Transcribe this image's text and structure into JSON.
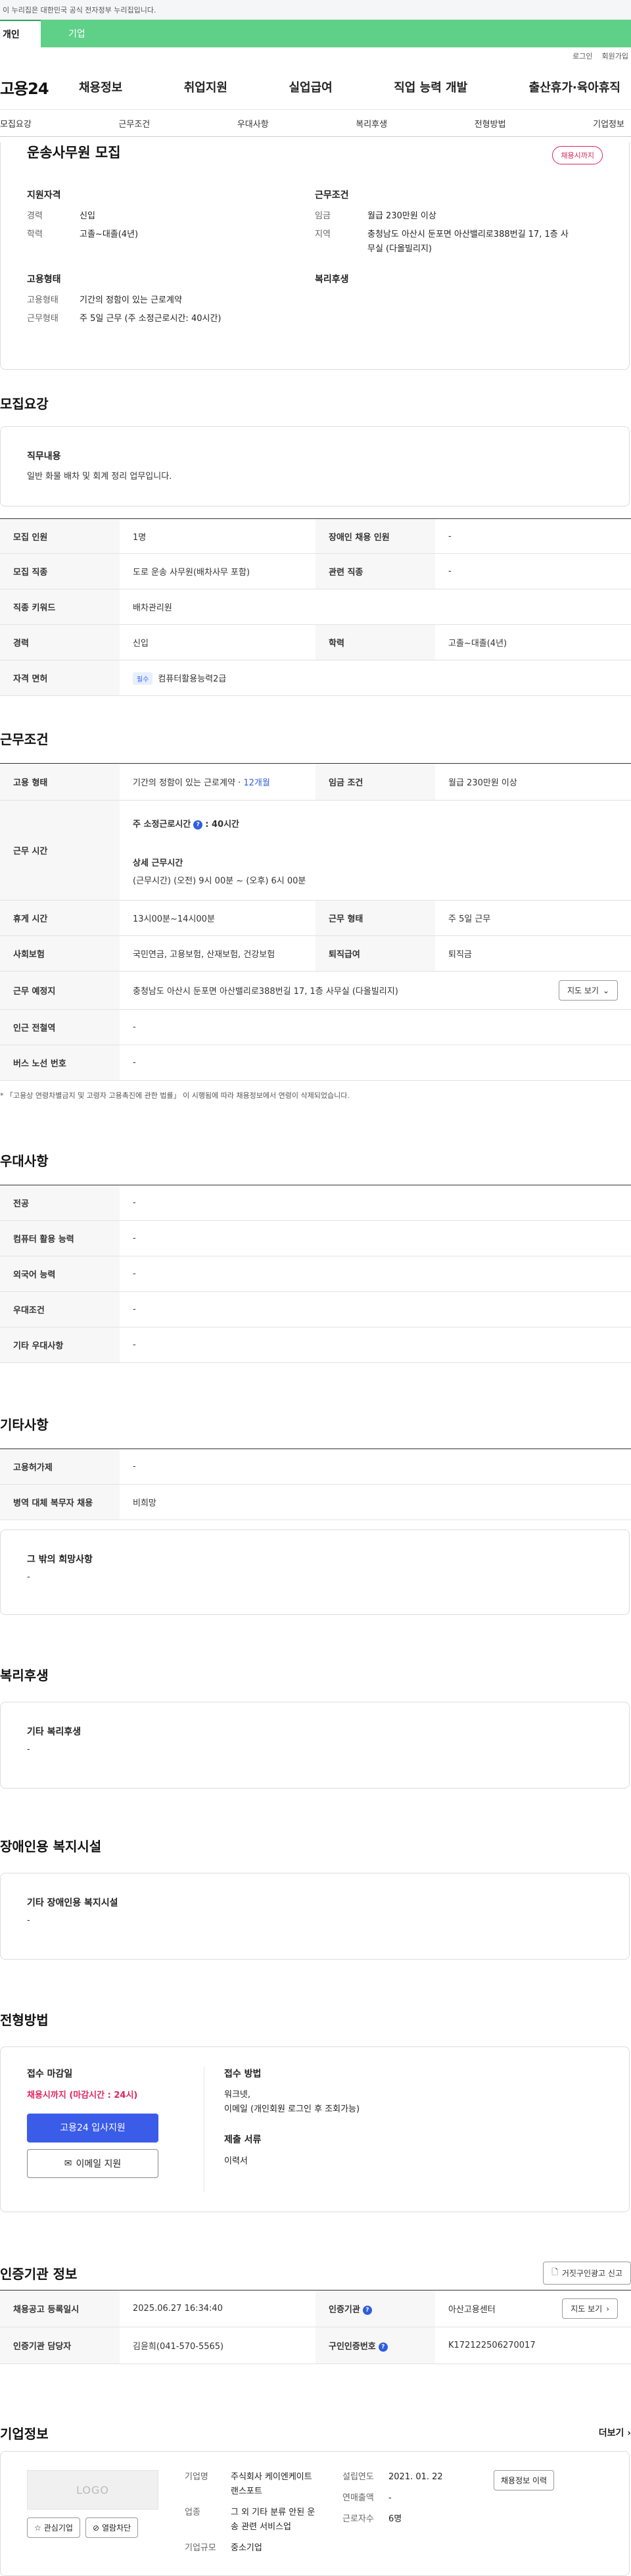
{
  "header": {
    "gov_notice": "이 누리집은 대한민국 공식 전자정부 누리집입니다.",
    "tab_personal": "개인",
    "tab_company": "기업",
    "login": "로그인",
    "join": "회원가입",
    "logo": "고용24",
    "menu": [
      "채용정보",
      "취업지원",
      "실업급여",
      "직업 능력 개발",
      "출산휴가·육아휴직"
    ]
  },
  "anchor_tabs": [
    "모집요강",
    "근무조건",
    "우대사항",
    "복리후생",
    "전형방법",
    "기업정보"
  ],
  "summary": {
    "title": "운송사무원 모집",
    "status": "채용시까지",
    "qualify_title": "지원자격",
    "career_label": "경력",
    "career_value": "신입",
    "edu_label": "학력",
    "edu_value": "고졸~대졸(4년)",
    "work_title": "근무조건",
    "wage_label": "임금",
    "wage_value": "월급 230만원 이상",
    "area_label": "지역",
    "area_value": "충청남도 아산시 둔포면 아산밸리로388번길 17, 1층 사무실 (다올빌리지)",
    "emp_title": "고용형태",
    "emp_type_label": "고용형태",
    "emp_type_value": "기간의 정함이 있는 근로계약",
    "work_form_label": "근무형태",
    "work_form_value": "주 5일 근무 (주 소정근로시간: 40시간)",
    "welfare_title": "복리후생"
  },
  "recruit": {
    "section_title": "모집요강",
    "duty_title": "직무내용",
    "duty_value": "일반 화물 배차 및 회계 정리 업무입니다.",
    "count_label": "모집 인원",
    "count_value": "1명",
    "disabled_label": "장애인 채용 인원",
    "disabled_value": "-",
    "job_label": "모집 직종",
    "job_value": "도로 운송 사무원(배차사무 포함)",
    "related_label": "관련 직종",
    "related_value": "-",
    "keyword_label": "직종 키워드",
    "keyword_value": "배차관리원",
    "career_label": "경력",
    "career_value": "신입",
    "edu_label": "학력",
    "edu_value": "고졸~대졸(4년)",
    "license_label": "자격 면허",
    "license_tag": "필수",
    "license_value": "컴퓨터활용능력2급"
  },
  "conditions": {
    "section_title": "근무조건",
    "emp_label": "고용 형태",
    "emp_value": "기간의 정함이 있는 근로계약 · ",
    "emp_period": "12개월",
    "wage_label": "임금 조건",
    "wage_value": "월급 230만원 이상",
    "hours_label": "근무 시간",
    "hours_title": "주 소정근로시간",
    "hours_value": ": 40시간",
    "detail_title": "상세 근무시간",
    "detail_value": "(근무시간) (오전) 9시 00분 ~ (오후) 6시 00분",
    "break_label": "휴게 시간",
    "break_value": "13시00분~14시00분",
    "form_label": "근무 형태",
    "form_value": "주 5일 근무",
    "insurance_label": "사회보험",
    "insurance_value": "국민연금, 고용보험, 산재보험, 건강보험",
    "retire_label": "퇴직급여",
    "retire_value": "퇴직금",
    "place_label": "근무 예정지",
    "place_value": "충청남도 아산시 둔포면 아산밸리로388번길 17, 1층 사무실 (다올빌리지)",
    "map_btn": "지도 보기",
    "subway_label": "인근 전철역",
    "subway_value": "-",
    "bus_label": "버스 노선 번호",
    "bus_value": "-",
    "note": "* 「고용상 연령차별금지 및 고령자 고용촉진에 관한 법률」 이 시행됨에 따라 채용정보에서 연령이 삭제되었습니다."
  },
  "preference": {
    "section_title": "우대사항",
    "rows": [
      {
        "label": "전공",
        "value": "-"
      },
      {
        "label": "컴퓨터 활용 능력",
        "value": "-"
      },
      {
        "label": "외국어 능력",
        "value": "-"
      },
      {
        "label": "우대조건",
        "value": "-"
      },
      {
        "label": "기타 우대사항",
        "value": "-"
      }
    ]
  },
  "other": {
    "section_title": "기타사항",
    "rows": [
      {
        "label": "고용허가제",
        "value": "-"
      },
      {
        "label": "병역 대체 복무자 채용",
        "value": "비희망"
      }
    ],
    "wish_title": "그 밖의 희망사항",
    "wish_value": "-"
  },
  "welfare": {
    "section_title": "복리후생",
    "box_title": "기타 복리후생",
    "box_value": "-"
  },
  "disabled_facility": {
    "section_title": "장애인용 복지시설",
    "box_title": "기타 장애인용 복지시설",
    "box_value": "-"
  },
  "apply": {
    "section_title": "전형방법",
    "deadline_title": "접수 마감일",
    "deadline_value": "채용시까지 (마감시간 : 24시)",
    "apply_btn": "고용24 입사지원",
    "email_btn": "이메일 지원",
    "method_title": "접수 방법",
    "method_value_1": "워크넷,",
    "method_value_2": "이메일 (개인회원 로그인 후 조회가능)",
    "docs_title": "제출 서류",
    "docs_value": "이력서"
  },
  "cert": {
    "section_title": "인증기관 정보",
    "report_btn": "거짓구인광고 신고",
    "reg_date_label": "채용공고 등록일시",
    "reg_date_value": "2025.06.27 16:34:40",
    "agency_label": "인증기관",
    "agency_value": "아산고용센터",
    "map_btn": "지도 보기",
    "manager_label": "인증기관 담당자",
    "manager_value": "김윤희(041-570-5565)",
    "cert_no_label": "구인인증번호",
    "cert_no_value": "K172122506270017"
  },
  "company": {
    "section_title": "기업정보",
    "more": "더보기",
    "logo_text": "LOGO",
    "fav_btn": "관심기업",
    "block_btn": "열람차단",
    "name_label": "기업명",
    "name_value": "주식회사 케이엔케이트랜스포트",
    "industry_label": "업종",
    "industry_value": "그 외 기타 분류 안된 운송 관련 서비스업",
    "size_label": "기업규모",
    "size_value": "중소기업",
    "founded_label": "설립연도",
    "founded_value": "2021. 01. 22",
    "sales_label": "연매출액",
    "sales_value": "-",
    "employees_label": "근로자수",
    "employees_value": "6명",
    "history_btn": "채용정보 이력"
  }
}
